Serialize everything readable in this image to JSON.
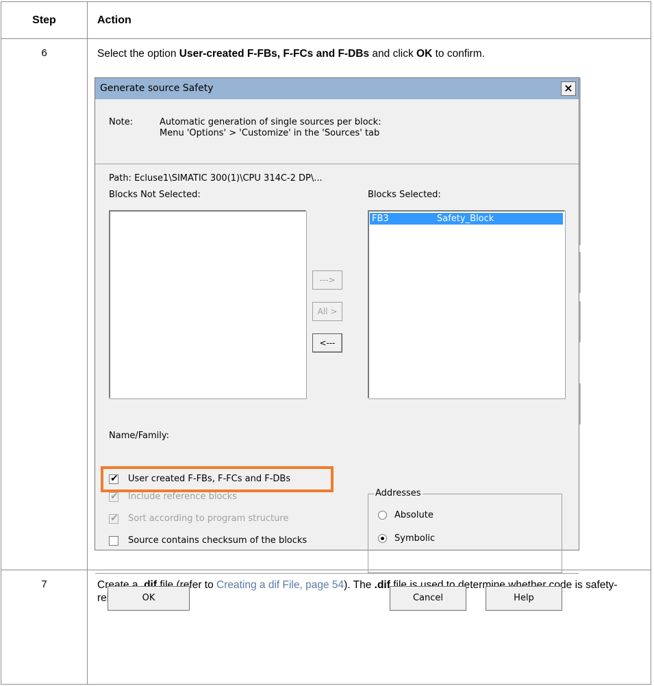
{
  "table": {
    "headers": {
      "step": "Step",
      "action": "Action"
    },
    "rows": [
      {
        "step": "6",
        "text_parts": [
          "Select the option ",
          "User-created F-FBs, F-FCs and F-DBs",
          " and click ",
          "OK",
          " to confirm."
        ]
      },
      {
        "step": "7",
        "text_parts": [
          "Create a ",
          ".dif",
          " file (refer to ",
          "Creating a dif File, page 54",
          "). The ",
          ".dif",
          " file is used to determine whether code is safety-related."
        ]
      }
    ]
  },
  "dialog": {
    "title": "Generate source Safety",
    "close_glyph": "×",
    "note_label": "Note:",
    "note_lines": [
      "Automatic generation of single sources per block:",
      "Menu 'Options' > 'Customize' in the 'Sources' tab"
    ],
    "path": "Path:  Ecluse1\\SIMATIC 300(1)\\CPU 314C-2 DP\\...",
    "blocks_not_selected_label": "Blocks Not Selected:",
    "blocks_selected_label": "Blocks Selected:",
    "selected_items": [
      {
        "name": "FB3",
        "symbol": "Safety_Block"
      }
    ],
    "move_buttons": {
      "add": "--->",
      "add_all": "All >",
      "remove": "<---"
    },
    "name_family_label": "Name/Family:",
    "checkboxes": [
      {
        "label": "User created F-FBs, F-FCs and F-DBs",
        "checked": true,
        "enabled": true,
        "highlighted": true
      },
      {
        "label": "Include reference blocks",
        "checked": true,
        "enabled": false
      },
      {
        "label": "Sort according to program structure",
        "checked": true,
        "enabled": false
      },
      {
        "label": "Source contains checksum of the blocks",
        "checked": false,
        "enabled": true
      }
    ],
    "addresses": {
      "legend": "Addresses",
      "options": [
        {
          "label": "Absolute",
          "selected": false
        },
        {
          "label": "Symbolic",
          "selected": true
        }
      ]
    },
    "buttons": {
      "ok": "OK",
      "cancel": "Cancel",
      "help": "Help"
    }
  },
  "colors": {
    "highlight": "#f07c2c",
    "link": "#5c7ba7",
    "titlebar": "#98b4d4",
    "selection": "#3399ff"
  }
}
